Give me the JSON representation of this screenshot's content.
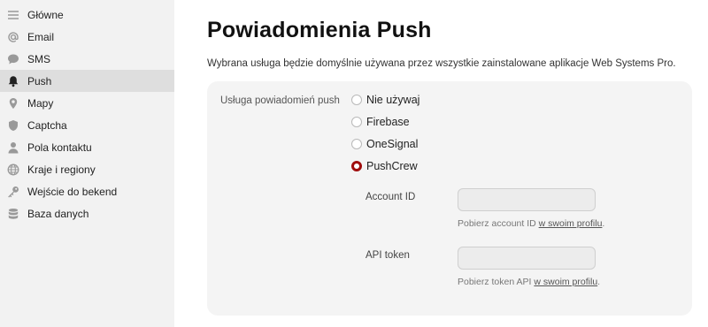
{
  "sidebar": {
    "items": [
      {
        "label": "Główne",
        "icon": "menu-lines-icon",
        "active": false
      },
      {
        "label": "Email",
        "icon": "at-sign-icon",
        "active": false
      },
      {
        "label": "SMS",
        "icon": "chat-bubble-icon",
        "active": false
      },
      {
        "label": "Push",
        "icon": "bell-icon",
        "active": true
      },
      {
        "label": "Mapy",
        "icon": "map-pin-icon",
        "active": false
      },
      {
        "label": "Captcha",
        "icon": "shield-icon",
        "active": false
      },
      {
        "label": "Pola kontaktu",
        "icon": "person-icon",
        "active": false
      },
      {
        "label": "Kraje i regiony",
        "icon": "globe-icon",
        "active": false
      },
      {
        "label": "Wejście do bekend",
        "icon": "key-icon",
        "active": false
      },
      {
        "label": "Baza danych",
        "icon": "database-icon",
        "active": false
      }
    ]
  },
  "main": {
    "title": "Powiadomienia Push",
    "description": "Wybrana usługa będzie domyślnie używana przez wszystkie zainstalowane aplikacje Web Systems Pro.",
    "service_label": "Usługa powiadomień push",
    "options": [
      {
        "label": "Nie używaj",
        "checked": false
      },
      {
        "label": "Firebase",
        "checked": false
      },
      {
        "label": "OneSignal",
        "checked": false
      },
      {
        "label": "PushCrew",
        "checked": true
      }
    ],
    "account_id": {
      "label": "Account ID",
      "value": "",
      "help_prefix": "Pobierz account ID ",
      "help_link": "w swoim profilu",
      "help_suffix": "."
    },
    "api_token": {
      "label": "API token",
      "value": "",
      "help_prefix": "Pobierz token API ",
      "help_link": "w swoim profilu",
      "help_suffix": "."
    }
  },
  "colors": {
    "accent": "#a00d0d",
    "sidebar_bg": "#f2f2f2",
    "sidebar_active": "#dedede",
    "card_bg": "#f4f4f4"
  }
}
